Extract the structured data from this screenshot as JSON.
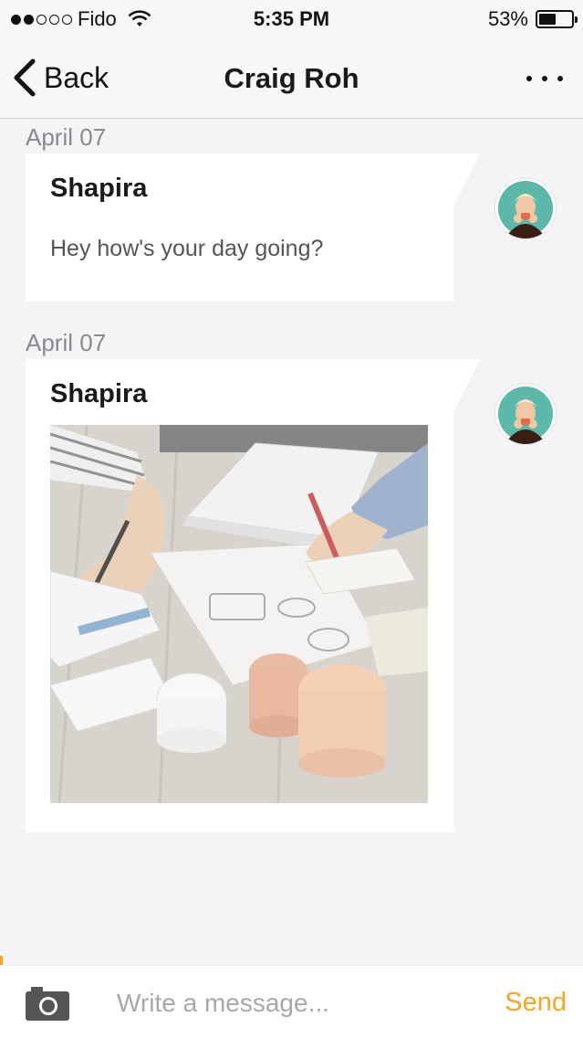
{
  "status_bar": {
    "carrier": "Fido",
    "time": "5:35 PM",
    "battery_percent": "53%",
    "battery_level": 0.53,
    "signal_bars_filled": 2,
    "signal_bars_total": 5
  },
  "nav": {
    "back_label": "Back",
    "title": "Craig Roh",
    "back_icon": "chevron-left-icon",
    "more_icon": "more-dots-icon"
  },
  "messages": [
    {
      "date": "April 07",
      "sender": "Shapira",
      "text": "Hey how's your day going?",
      "type": "text"
    },
    {
      "date": "April 07",
      "sender": "Shapira",
      "type": "image",
      "image_description_icon": "photo-desk-sketching"
    }
  ],
  "composer": {
    "placeholder": "Write a message...",
    "value": "",
    "send_label": "Send",
    "camera_icon": "camera-icon"
  },
  "colors": {
    "accent": "#f5a623",
    "background": "#f4f4f6",
    "bubble": "#ffffff"
  }
}
